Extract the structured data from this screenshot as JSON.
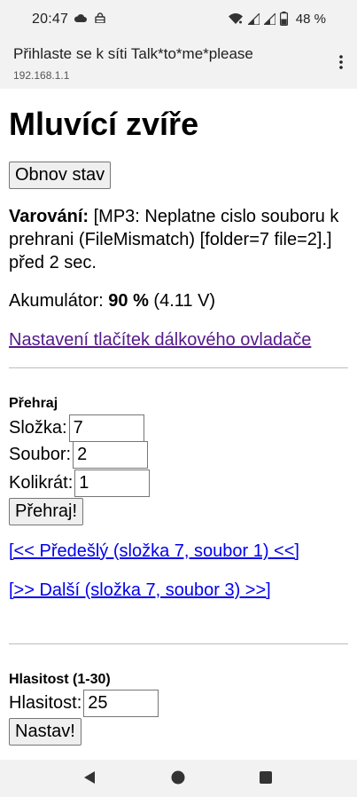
{
  "status": {
    "time": "20:47",
    "battery": "48 %"
  },
  "browser": {
    "title": "Přihlaste se k síti Talk*to*me*please",
    "url": "192.168.1.1"
  },
  "page": {
    "title": "Mluvící zvíře",
    "refresh_label": "Obnov stav",
    "warning_label": "Varování:",
    "warning_text": " [MP3: Neplatne cislo souboru k prehrani (FileMismatch) [folder=7 file=2].] před 2 sec.",
    "battery_label": "Akumulátor: ",
    "battery_percent": "90 %",
    "battery_voltage": " (4.11 V)",
    "remote_link": "Nastavení tlačítek dálkového ovladače",
    "play": {
      "heading": "Přehraj",
      "folder_label": "Složka:",
      "folder_value": "7",
      "file_label": "Soubor:",
      "file_value": "2",
      "count_label": "Kolikrát:",
      "count_value": "1",
      "button": "Přehraj!"
    },
    "prev_link": "[<< Předešlý (složka 7, soubor 1) <<]",
    "next_link": "[>> Další (složka 7, soubor 3) >>]",
    "volume": {
      "heading": "Hlasitost (1-30)",
      "label": "Hlasitost:",
      "value": "25",
      "button": "Nastav!"
    }
  },
  "icons": {
    "statusbar": [
      "cloud-icon",
      "lock-icon",
      "wifi-icon",
      "signal-icon",
      "signal-icon",
      "battery-icon"
    ],
    "browser": [
      "more-vert-icon"
    ],
    "navbar": [
      "back-icon",
      "home-icon",
      "recents-icon"
    ]
  }
}
